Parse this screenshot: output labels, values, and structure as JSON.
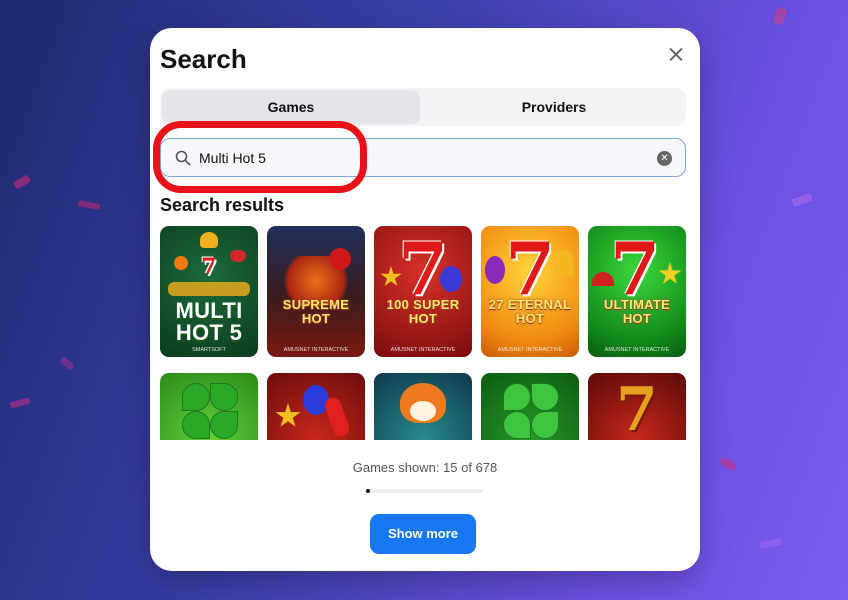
{
  "modal": {
    "title": "Search",
    "tabs": [
      {
        "label": "Games",
        "active": true
      },
      {
        "label": "Providers",
        "active": false
      }
    ],
    "search": {
      "value": "Multi Hot 5",
      "placeholder": ""
    },
    "results_title": "Search results",
    "games": [
      {
        "title": "MULTI HOT 5",
        "provider": "SMARTSOFT"
      },
      {
        "title": "SUPREME HOT",
        "provider": "AMUSNET INTERACTIVE"
      },
      {
        "title": "100 SUPER HOT",
        "provider": "AMUSNET INTERACTIVE"
      },
      {
        "title": "27 ETERNAL HOT",
        "provider": "AMUSNET INTERACTIVE"
      },
      {
        "title": "ULTIMATE HOT",
        "provider": "AMUSNET INTERACTIVE"
      }
    ],
    "games_shown": "Games shown: 15 of 678",
    "progress_fraction": 0.022,
    "show_more_label": "Show more"
  },
  "colors": {
    "accent": "#1877f2",
    "highlight": "#e8121a"
  }
}
